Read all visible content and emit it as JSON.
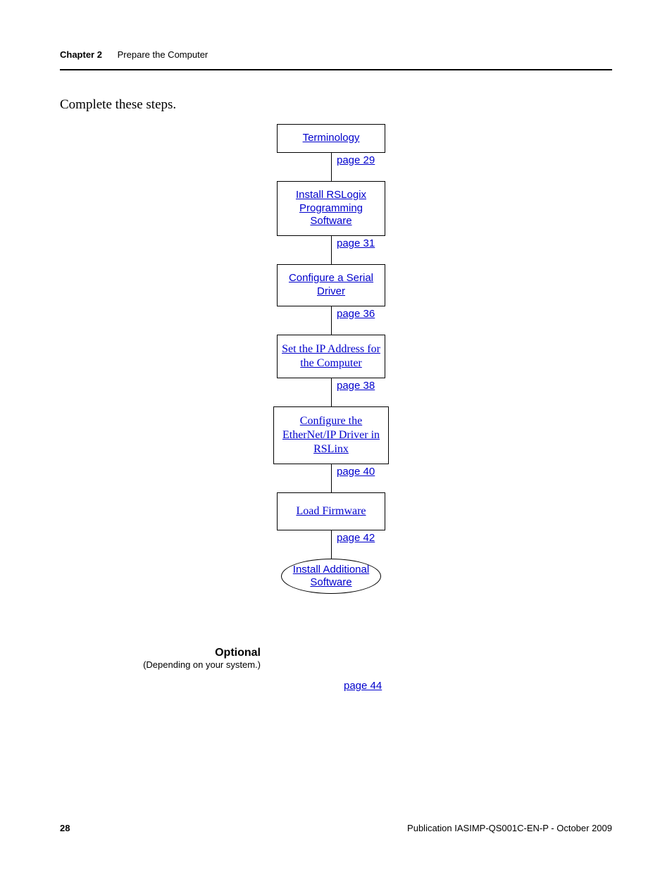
{
  "header": {
    "chapter": "Chapter 2",
    "title": "Prepare the Computer"
  },
  "intro": "Complete these steps.",
  "flow": {
    "nodes": [
      {
        "label": "Terminology",
        "page": "page 29"
      },
      {
        "label": "Install RSLogix Programming Software",
        "page": "page 31"
      },
      {
        "label": "Configure a Serial Driver",
        "page": "page 36"
      },
      {
        "label": "Set the IP Address for the Computer",
        "page": "page 38",
        "serif": true
      },
      {
        "label": "Configure the EtherNet/IP Driver in RSLinx",
        "page": "page 40",
        "serif": true
      },
      {
        "label": "Load Firmware",
        "page": "page 42",
        "serif": true
      }
    ],
    "oval": {
      "label": "Install Additional Software",
      "page": "page 44"
    }
  },
  "optional": {
    "title": "Optional",
    "sub": "(Depending on your system.)"
  },
  "footer": {
    "pagenum": "28",
    "pub": "Publication IASIMP-QS001C-EN-P - October 2009"
  }
}
